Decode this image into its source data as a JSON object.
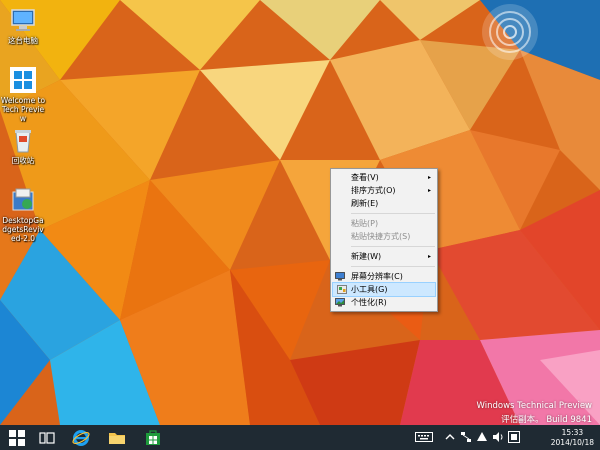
{
  "desktop": {
    "icons": [
      {
        "label": "这台电脑"
      },
      {
        "label": "Welcome to Tech Preview"
      },
      {
        "label": "回收站"
      },
      {
        "label": "DesktopGadgetsRevived-2.0"
      }
    ],
    "watermark": {
      "line1": "Windows Technical Preview",
      "line2": "评估副本。 Build 9841"
    }
  },
  "context_menu": {
    "items": [
      {
        "label": "查看(V)",
        "submenu": true,
        "disabled": false
      },
      {
        "label": "排序方式(O)",
        "submenu": true,
        "disabled": false
      },
      {
        "label": "刷新(E)",
        "submenu": false,
        "disabled": false
      },
      {
        "label": "粘贴(P)",
        "submenu": false,
        "disabled": true
      },
      {
        "label": "粘贴快捷方式(S)",
        "submenu": false,
        "disabled": true
      },
      {
        "label": "新建(W)",
        "submenu": true,
        "disabled": false
      },
      {
        "label": "屏幕分辨率(C)",
        "icon": "monitor-icon"
      },
      {
        "label": "小工具(G)",
        "icon": "gadgets-icon",
        "hover": true
      },
      {
        "label": "个性化(R)",
        "icon": "personalize-icon"
      }
    ],
    "submenu_arrow": "▸"
  },
  "taskbar": {
    "clock": {
      "time": "15:33",
      "date": "2014/10/18"
    }
  },
  "colors": {
    "taskbar": "#1f2a33",
    "menu_bg": "#f2f2f2",
    "menu_hover": "#cde8ff",
    "start_blue": "#2b9be8"
  }
}
